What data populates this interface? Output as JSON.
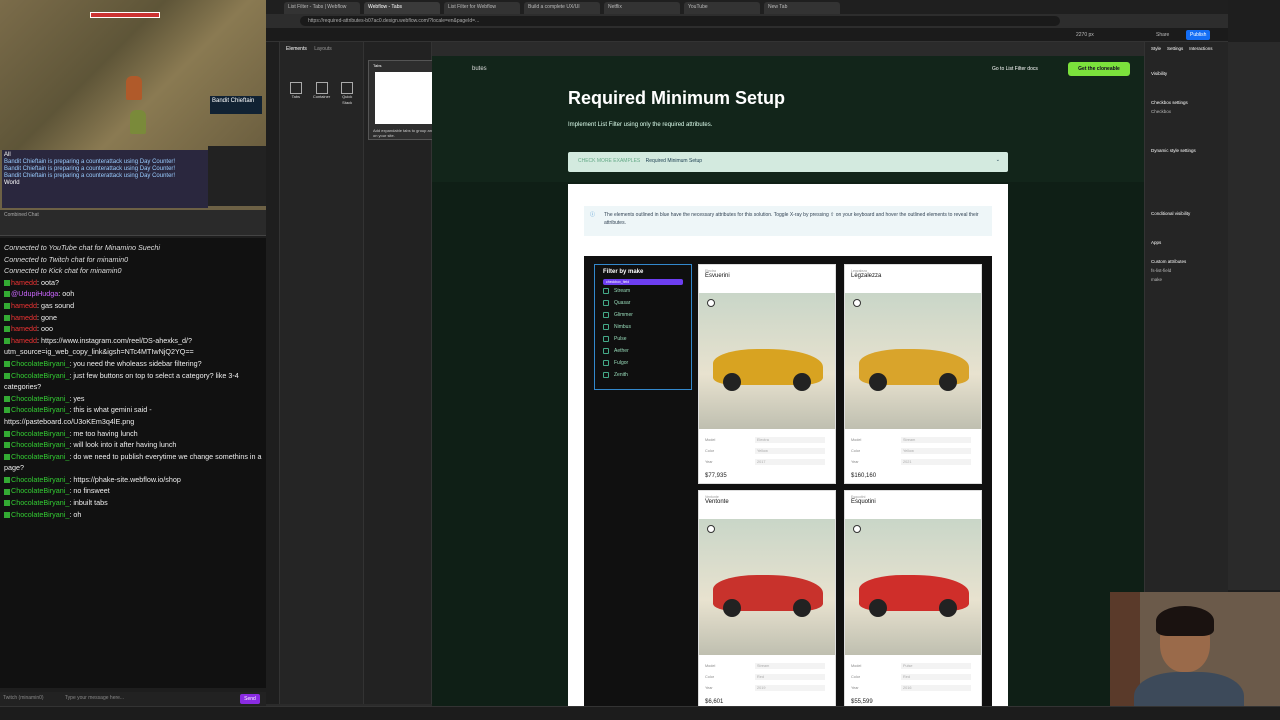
{
  "game": {
    "target_name": "Bandit Chieftain",
    "log": [
      "Bandit Chieftain is preparing a counterattack using Day Counter!",
      "Bandit Chieftain is preparing a counterattack using Day Counter!",
      "Bandit Chieftain is preparing a counterattack using Day Counter!"
    ],
    "world_label": "World",
    "all_label": "All"
  },
  "chat": {
    "header": "Combined Chat",
    "messages": [
      {
        "type": "sys",
        "text": "Connected to YouTube chat for Minamino Suechi"
      },
      {
        "type": "sys",
        "text": "Connected to Twitch chat for minamin0"
      },
      {
        "type": "sys",
        "text": "Connected to Kick chat for minamin0"
      },
      {
        "type": "msg",
        "user": "hamedd",
        "cls": "u1",
        "text": ": oota?"
      },
      {
        "type": "msg",
        "user": "@UdupiHudga",
        "cls": "u3",
        "text": ": ooh"
      },
      {
        "type": "msg",
        "user": "hamedd",
        "cls": "u1",
        "text": ": gas sound"
      },
      {
        "type": "msg",
        "user": "hamedd",
        "cls": "u1",
        "text": ": gone"
      },
      {
        "type": "msg",
        "user": "hamedd",
        "cls": "u1",
        "text": ": ooo"
      },
      {
        "type": "msg",
        "user": "hamedd",
        "cls": "u1",
        "text": ": https://www.instagram.com/reel/DS-ahexks_d/?utm_source=ig_web_copy_link&igsh=NTc4MTIwNjQ2YQ=="
      },
      {
        "type": "msg",
        "user": "ChocolateBiryani_",
        "cls": "u2",
        "text": ": you need the wholeass sidebar filtering?"
      },
      {
        "type": "msg",
        "user": "ChocolateBiryani_",
        "cls": "u2",
        "text": ": just few buttons on top to select a category? like 3-4 categories?"
      },
      {
        "type": "msg",
        "user": "ChocolateBiryani_",
        "cls": "u2",
        "text": ": yes"
      },
      {
        "type": "msg",
        "user": "ChocolateBiryani_",
        "cls": "u2",
        "text": ": this is what gemini said - https://pasteboard.co/U3oKEm3q4lE.png"
      },
      {
        "type": "msg",
        "user": "ChocolateBiryani_",
        "cls": "u2",
        "text": ": me too having lunch"
      },
      {
        "type": "msg",
        "user": "ChocolateBiryani_",
        "cls": "u2",
        "text": ": will look into it after having lunch"
      },
      {
        "type": "msg",
        "user": "ChocolateBiryani_",
        "cls": "u2",
        "text": ": do we need to publish everytime we change somethins in a page?"
      },
      {
        "type": "msg",
        "user": "ChocolateBiryani_",
        "cls": "u2",
        "text": ": https://phake-site.webflow.io/shop"
      },
      {
        "type": "msg",
        "user": "ChocolateBiryani_",
        "cls": "u2",
        "text": ": no finsweet"
      },
      {
        "type": "msg",
        "user": "ChocolateBiryani_",
        "cls": "u2",
        "text": ": inbuilt tabs"
      },
      {
        "type": "msg",
        "user": "ChocolateBiryani_",
        "cls": "u2",
        "text": ": oh"
      }
    ],
    "input_placeholder": "Type your message here...",
    "send_label": "Send",
    "platform_label": "Twitch (minamin0)"
  },
  "browser": {
    "tabs": [
      "List Filter - Tabs | Webflow",
      "Webflow - Tabs",
      "List Filter for Webflow",
      "Build a complete UX/UI",
      "Netflix",
      "YouTube",
      "New Tab"
    ],
    "url": "https://required-attributes-b07ac0.design.webflow.com/?locale=en&pageId=..."
  },
  "webflow": {
    "add_tabs": [
      "Elements",
      "Layouts"
    ],
    "elements": [
      "Tabs",
      "Container",
      "Quick Stack"
    ],
    "popup_text": "Add expandable tabs to group and organize content on your site.",
    "popup_title": "Tabs",
    "breadcrumb_text": "butes",
    "goto_label": "Go to List Filter docs",
    "cta_label": "Get the cloneable",
    "zoom": "2270 px",
    "publish_label": "Publish",
    "share_label": "Share"
  },
  "page": {
    "title": "Required Minimum Setup",
    "subtitle": "Implement List Filter using only the required attributes.",
    "examples_prefix": "CHECK MORE EXAMPLES",
    "examples_label": "Required Minimum Setup",
    "note": "The elements outlined in blue have the necessary attributes for this solution. Toggle X-ray by pressing ⇧ on your keyboard and hover the outlined elements to reveal their attributes.",
    "filter_title": "Filter by make",
    "filter_chip": "checkbox_field",
    "filter_items": [
      "Stream",
      "Quasar",
      "Glimmer",
      "Nimbus",
      "Pulse",
      "Aether",
      "Fulgor",
      "Zenith"
    ]
  },
  "cards": [
    {
      "maker": "Electra",
      "name": "Esvuerini",
      "model": "Electra",
      "color": "Yellow",
      "year": "2017",
      "price": "$77,935",
      "paint": "#d8a321"
    },
    {
      "maker": "Legzaleza",
      "name": "Legzalezza",
      "model": "Stream",
      "color": "Yellow",
      "year": "2021",
      "price": "$160,160",
      "paint": "#d9a42b"
    },
    {
      "maker": "Ventonte",
      "name": "Ventonte",
      "model": "Stream",
      "color": "Red",
      "year": "2019",
      "price": "$6,601",
      "paint": "#c8322c"
    },
    {
      "maker": "Esquotini",
      "name": "Esquotini",
      "model": "Pulse",
      "color": "Red",
      "year": "2016",
      "price": "$55,599",
      "paint": "#cf2e2a"
    }
  ],
  "card_labels": {
    "model": "Model",
    "color": "Color",
    "year": "Year"
  },
  "right_panel": {
    "tabs": [
      "Style",
      "Settings",
      "Interactions"
    ],
    "sections": [
      "Visibility",
      "Checkbox settings",
      "Dynamic style settings",
      "Conditional visibility",
      "Apps",
      "Custom attributes"
    ],
    "checkbox_name": "Checkbox",
    "attr_name": "fs-list-field",
    "attr_value": "make"
  }
}
